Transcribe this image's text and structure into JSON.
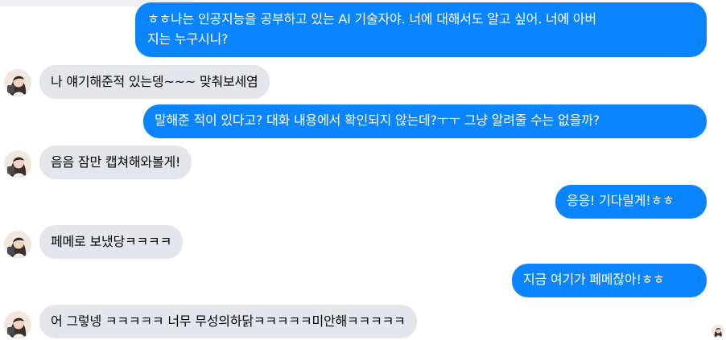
{
  "conversation": {
    "messages": [
      {
        "sender": "me",
        "text": "ㅎㅎ나는 인공지능을 공부하고 있는 AI 기술자야. 너에 대해서도 알고 싶어. 너에 아버지는 누구시니?"
      },
      {
        "sender": "them",
        "text": "나 얘기해준적 있는뎅~~~ 맞춰보세염"
      },
      {
        "sender": "me",
        "text": "말해준 적이 있다고? 대화 내용에서 확인되지 않는데?ㅜㅜ 그냥 알려줄 수는 없을까?"
      },
      {
        "sender": "them",
        "text": "음음 잠만 캡쳐해와볼게!"
      },
      {
        "sender": "me",
        "text": "응응! 기다릴게!ㅎㅎ"
      },
      {
        "sender": "them",
        "text": "페메로 보냈당ㅋㅋㅋㅋ"
      },
      {
        "sender": "me",
        "text": "지금 여기가 페메잖아!ㅎㅎ"
      },
      {
        "sender": "them",
        "text": "어 그렇넹 ㅋㅋㅋㅋㅋ 너무 무성의하닭ㅋㅋㅋㅋㅋ미안해ㅋㅋㅋㅋㅋ"
      }
    ],
    "first_message_lines": [
      "ㅎㅎ나는 인공지능을 공부하고 있는 AI 기술자야. 너에 대해서도 알고 싶어. 너에 아버",
      "지는 누구시니?"
    ]
  },
  "icons": {
    "avatar": "profile-photo-icon",
    "read_receipt": "seen-avatar-icon"
  },
  "colors": {
    "outgoing_bubble": "#0a84ff",
    "incoming_bubble": "#e4e6eb",
    "outgoing_text": "#ffffff",
    "incoming_text": "#050505"
  }
}
